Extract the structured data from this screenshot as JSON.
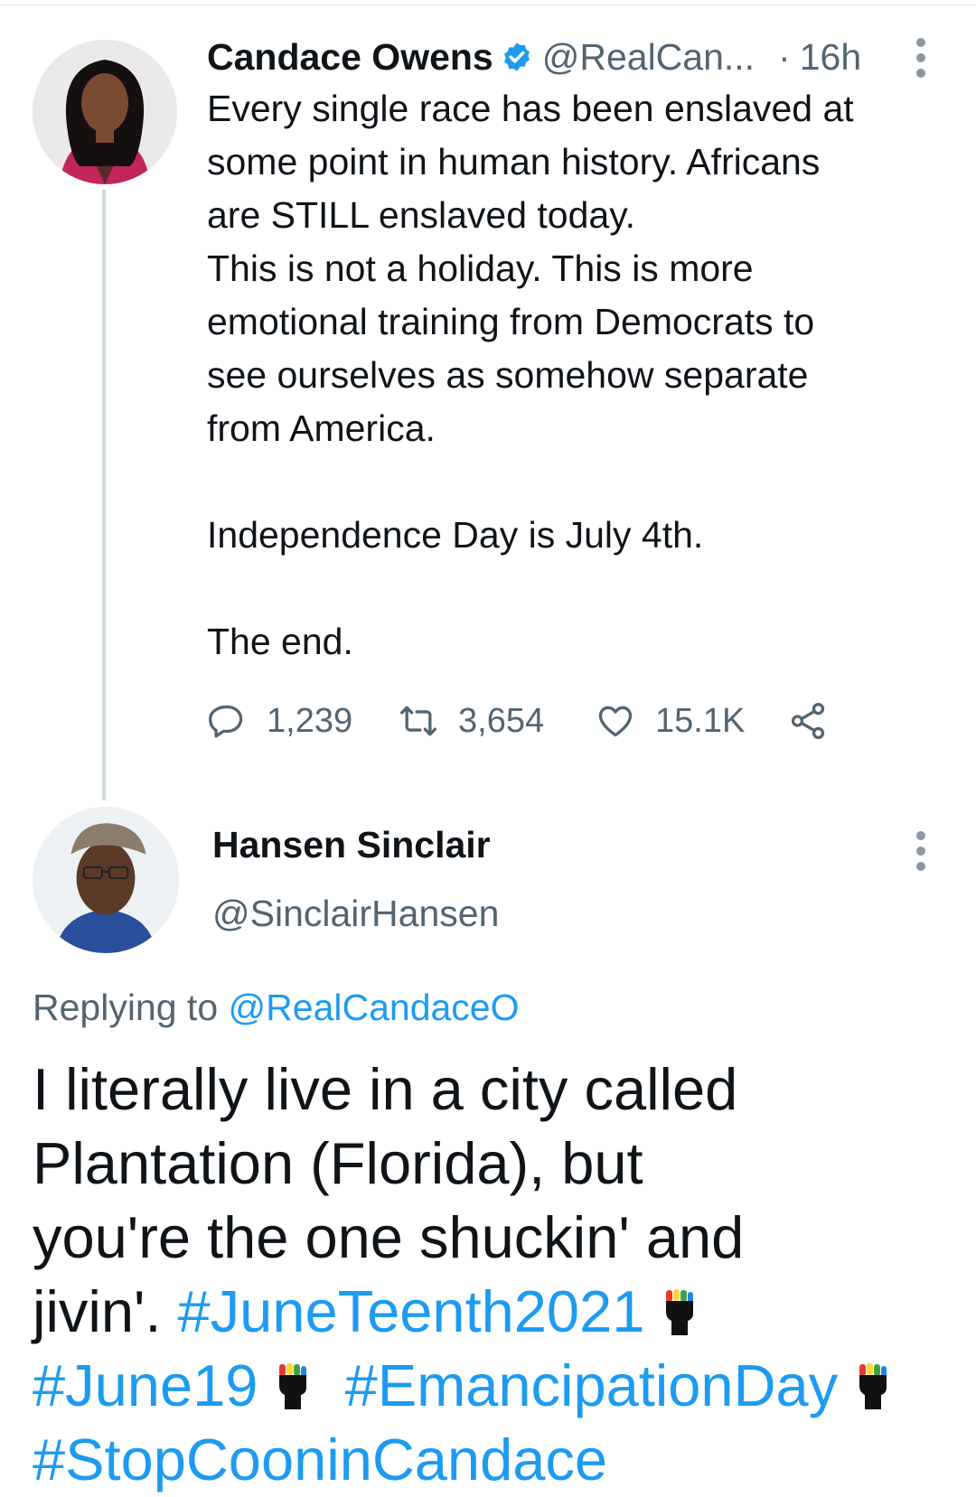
{
  "parent_tweet": {
    "author_name": "Candace Owens",
    "handle": "@RealCan...",
    "separator": "·",
    "time": "16h",
    "body_lines": [
      "Every single race has been enslaved at",
      "some point in human history. Africans",
      "are STILL enslaved today.",
      "This is not a holiday. This is more",
      "emotional training from Democrats to",
      "see ourselves as somehow separate",
      "from America."
    ],
    "paragraph_2": "Independence Day is July 4th.",
    "paragraph_3": "The end.",
    "stats": {
      "replies": "1,239",
      "retweets": "3,654",
      "likes": "15.1K"
    }
  },
  "reply_tweet": {
    "author_name": "Hansen Sinclair",
    "handle": "@SinclairHansen",
    "replying_label": "Replying to",
    "replying_to": "@RealCandaceO",
    "text_1": "I literally live in a city called",
    "text_2": "Plantation (Florida),  but",
    "text_3": "you're the one shuckin' and",
    "text_4": "jivin'.",
    "hashtags": [
      "#JuneTeenth2021",
      "#June19",
      "#EmancipationDay",
      "#StopCooninCandace"
    ]
  },
  "colors": {
    "link": "#1d9bf0",
    "secondary_text": "#536471",
    "verified": "#1d9bf0",
    "thread_line": "#cfd9de"
  }
}
